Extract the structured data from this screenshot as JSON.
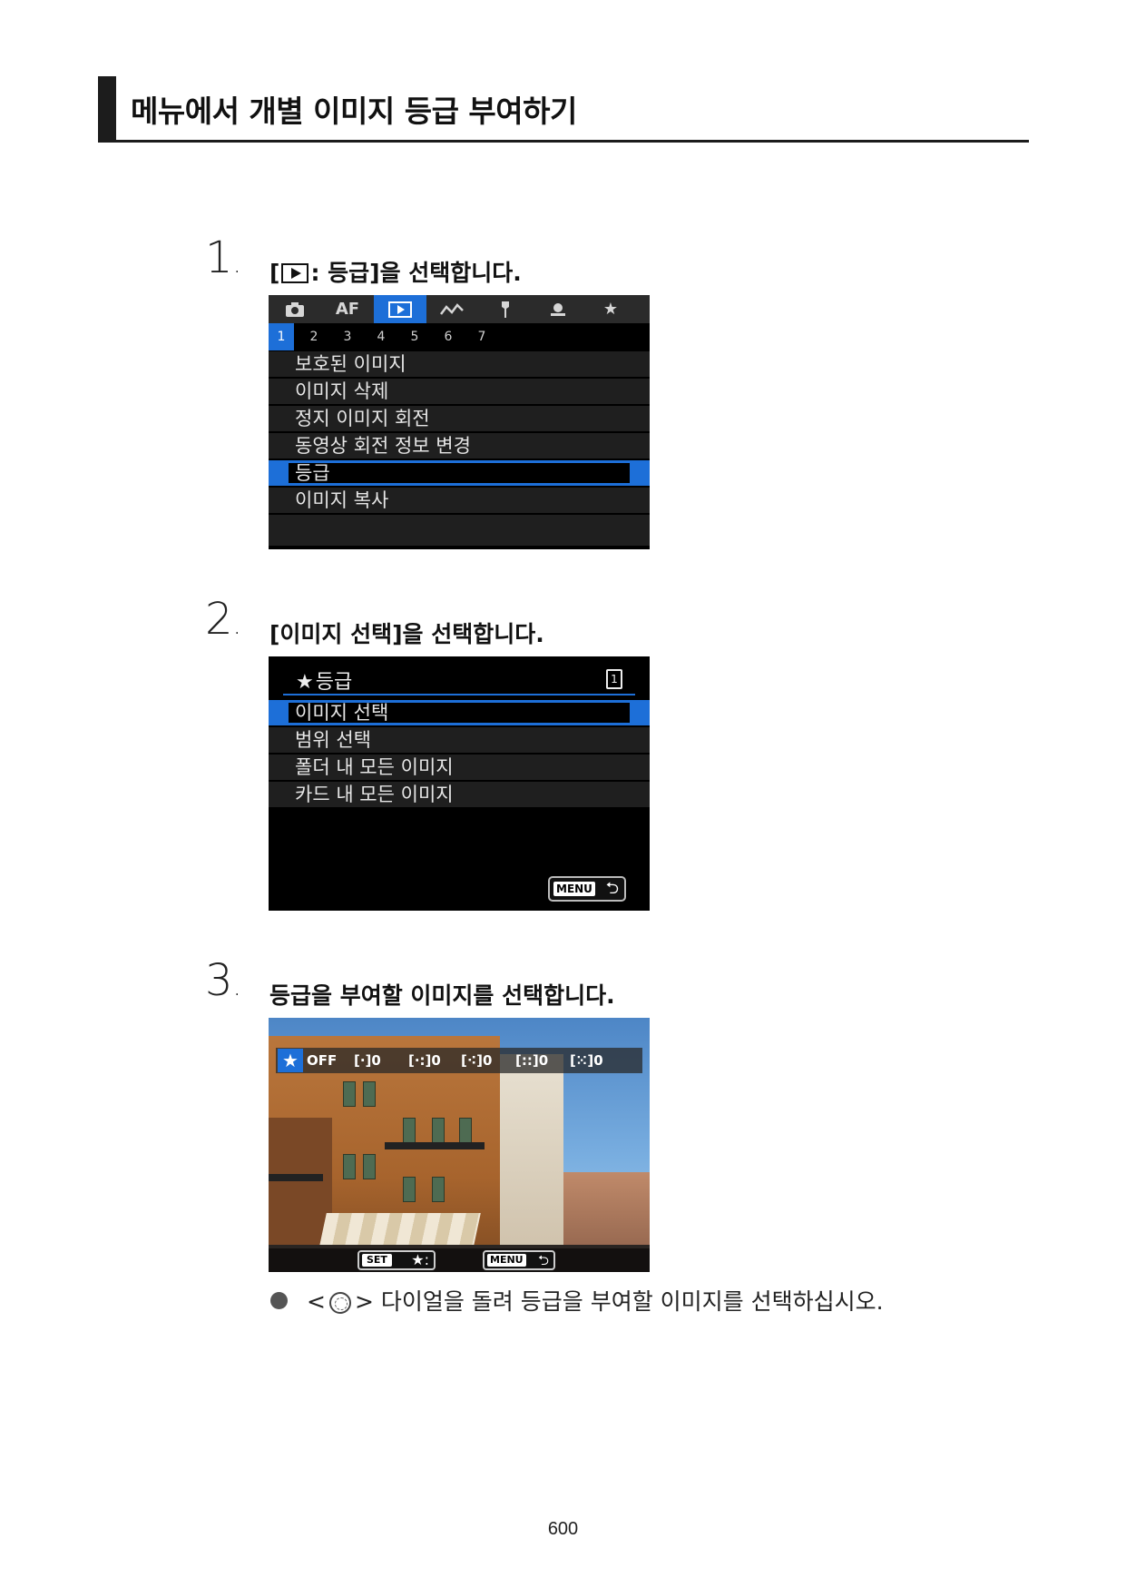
{
  "section": {
    "title": "메뉴에서 개별 이미지 등급 부여하기"
  },
  "steps": [
    {
      "number": "1",
      "text_before": "[",
      "text_after": ": 등급]을 선택합니다."
    },
    {
      "number": "2",
      "text": "[이미지 선택]을 선택합니다."
    },
    {
      "number": "3",
      "text": "등급을 부여할 이미지를 선택합니다."
    }
  ],
  "screen1": {
    "tabs": [
      "camera-icon",
      "AF",
      "playback-icon",
      "custom-icon",
      "setup-icon",
      "wifi-icon",
      "★"
    ],
    "active_tab": 2,
    "subtabs": [
      "1",
      "2",
      "3",
      "4",
      "5",
      "6",
      "7"
    ],
    "active_subtab": 0,
    "items": [
      "보호된 이미지",
      "이미지 삭제",
      "정지 이미지 회전",
      "동영상 회전 정보 변경",
      "등급",
      "이미지 복사"
    ],
    "selected_item": 4,
    "accent": "#1d6fd8"
  },
  "screen2": {
    "title_star": "★",
    "title": "등급",
    "page_icon": "1",
    "items": [
      "이미지 선택",
      "범위 선택",
      "폴더 내 모든 이미지",
      "카드 내 모든 이미지"
    ],
    "selected_item": 0,
    "menu_label": "MENU",
    "return_icon": "⮌"
  },
  "screen3": {
    "star": "★",
    "off": "OFF",
    "ratings": [
      "[·]0",
      "[·:]0",
      "[⁖]0",
      "[::]0",
      "[⁙]0"
    ],
    "set_label": "SET",
    "set_icon": "★:",
    "menu_label": "MENU",
    "return_icon": "⮌"
  },
  "bullet": {
    "open": "<",
    "close": ">",
    "text": "다이얼을 돌려 등급을 부여할 이미지를 선택하십시오."
  },
  "page_number": "600"
}
